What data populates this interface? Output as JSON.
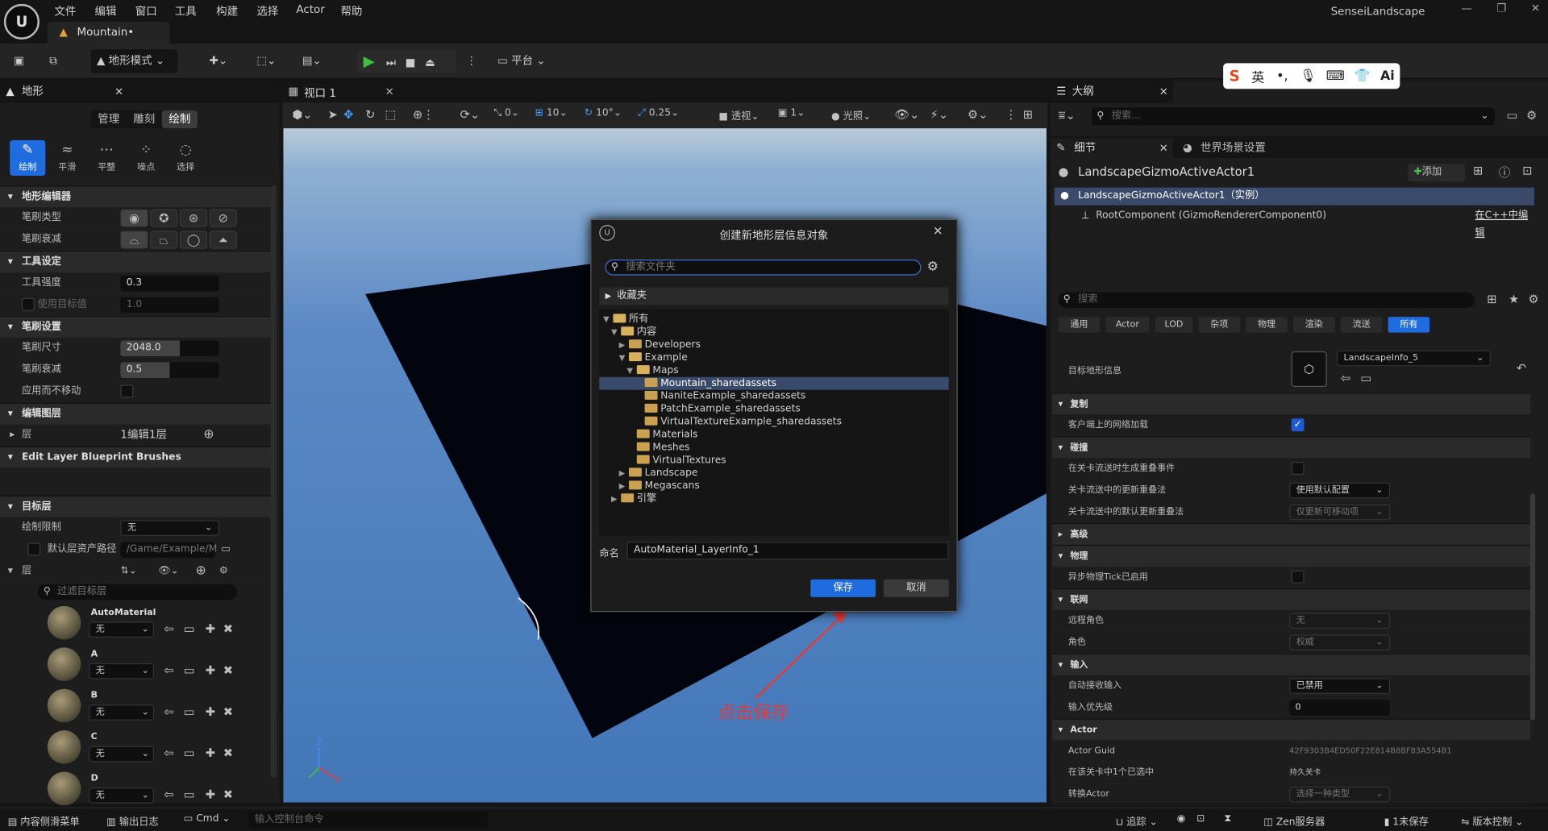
{
  "menu": [
    "文件",
    "编辑",
    "窗口",
    "工具",
    "构建",
    "选择",
    "Actor",
    "帮助"
  ],
  "window_title": "SenseiLandscape",
  "window_controls": [
    "—",
    "❐",
    "✕"
  ],
  "doc_tab": "Mountain•",
  "toolbar": {
    "mode": "地形模式",
    "platform": "平台"
  },
  "left_panel": {
    "title": "地形",
    "close": "×",
    "modes": [
      "管理",
      "雕刻",
      "绘制"
    ],
    "tools": [
      "绘制",
      "平滑",
      "平整",
      "噪点",
      "选择"
    ],
    "sections": {
      "editor": "地形编辑器",
      "tool_settings": "工具设定",
      "brush_settings": "笔刷设置",
      "edit_layers": "编辑图层",
      "blueprint": "Edit Layer Blueprint Brushes",
      "target_layers": "目标层"
    },
    "props": {
      "brush_type": "笔刷类型",
      "brush_falloff": "笔刷衰减",
      "tool_strength": "工具强度",
      "tool_strength_val": "0.3",
      "use_target": "使用目标值",
      "use_target_val": "1.0",
      "brush_size": "笔刷尺寸",
      "brush_size_val": "2048.0",
      "falloff": "笔刷衰减",
      "falloff_val": "0.5",
      "apply_no_move": "应用而不移动",
      "layer": "层",
      "layer_val": "1编辑1层",
      "paint_limit": "绘制限制",
      "paint_limit_val": "无",
      "default_path": "默认层资产路径",
      "default_path_val": "/Game/Example/M",
      "layers": "层"
    },
    "filter_placeholder": "过滤目标层",
    "layer_items": [
      {
        "name": "AutoMaterial",
        "val": "无"
      },
      {
        "name": "A",
        "val": "无"
      },
      {
        "name": "B",
        "val": "无"
      },
      {
        "name": "C",
        "val": "无"
      },
      {
        "name": "D",
        "val": "无"
      }
    ]
  },
  "viewport": {
    "tab": "视口 1",
    "perspective": "透视",
    "lit": "光照",
    "snap_move": "10",
    "snap_rot": "10°",
    "snap_scale": "0.25",
    "zero": "0",
    "one": "1",
    "axis_z": "Z",
    "axis_x": "X",
    "annotation": "点击保存"
  },
  "dialog": {
    "title": "创建新地形层信息对象",
    "close": "✕",
    "search_placeholder": "搜索文件夹",
    "favorites": "收藏夹",
    "tree": [
      {
        "label": "所有",
        "depth": 0,
        "arrow": "▼",
        "open": true
      },
      {
        "label": "内容",
        "depth": 1,
        "arrow": "▼",
        "open": true
      },
      {
        "label": "Developers",
        "depth": 2,
        "arrow": "▶",
        "open": false
      },
      {
        "label": "Example",
        "depth": 2,
        "arrow": "▼",
        "open": true
      },
      {
        "label": "Maps",
        "depth": 3,
        "arrow": "▼",
        "open": true
      },
      {
        "label": "Mountain_sharedassets",
        "depth": 4,
        "arrow": "",
        "open": false,
        "selected": true
      },
      {
        "label": "NaniteExample_sharedassets",
        "depth": 4,
        "arrow": "",
        "open": false
      },
      {
        "label": "PatchExample_sharedassets",
        "depth": 4,
        "arrow": "",
        "open": false
      },
      {
        "label": "VirtualTextureExample_sharedassets",
        "depth": 4,
        "arrow": "",
        "open": false
      },
      {
        "label": "Materials",
        "depth": 3,
        "arrow": "",
        "open": false
      },
      {
        "label": "Meshes",
        "depth": 3,
        "arrow": "",
        "open": false
      },
      {
        "label": "VirtualTextures",
        "depth": 3,
        "arrow": "",
        "open": false
      },
      {
        "label": "Landscape",
        "depth": 2,
        "arrow": "▶",
        "open": false
      },
      {
        "label": "Megascans",
        "depth": 2,
        "arrow": "▶",
        "open": false
      },
      {
        "label": "引擎",
        "depth": 1,
        "arrow": "▶",
        "open": false
      }
    ],
    "name_label": "命名",
    "name_value": "AutoMaterial_LayerInfo_1",
    "save": "保存",
    "cancel": "取消"
  },
  "outliner": {
    "title": "大纲",
    "close": "×",
    "search_placeholder": "搜索..."
  },
  "details": {
    "tab_details": "细节",
    "tab_world": "世界场景设置",
    "close": "×",
    "actor_name": "LandscapeGizmoActiveActor1",
    "add": "添加",
    "instance": "LandscapeGizmoActiveActor1（实例）",
    "root": "RootComponent (GizmoRendererComponent0)",
    "edit_cpp": "在C++中编辑",
    "search_placeholder": "搜索",
    "filters": [
      "通用",
      "Actor",
      "LOD",
      "杂项",
      "物理",
      "渲染",
      "流送",
      "所有"
    ],
    "target_info_label": "目标地形信息",
    "target_info_val": "LandscapeInfo_5",
    "rows": [
      {
        "type": "section",
        "label": "复制"
      },
      {
        "type": "check",
        "label": "客户端上的网络加载",
        "checked": true
      },
      {
        "type": "section",
        "label": "碰撞"
      },
      {
        "type": "check",
        "label": "在关卡流送时生成重叠事件",
        "checked": false
      },
      {
        "type": "dropdown",
        "label": "关卡流送中的更新重叠法",
        "val": "使用默认配置",
        "dim": false
      },
      {
        "type": "dropdown",
        "label": "关卡流送中的默认更新重叠法",
        "val": "仅更新可移动项",
        "dim": true
      },
      {
        "type": "section",
        "label": "高级",
        "collapsed": true
      },
      {
        "type": "section",
        "label": "物理"
      },
      {
        "type": "check",
        "label": "异步物理Tick已启用",
        "checked": false
      },
      {
        "type": "section",
        "label": "联网"
      },
      {
        "type": "dropdown",
        "label": "远程角色",
        "val": "无",
        "dim": true
      },
      {
        "type": "dropdown",
        "label": "角色",
        "val": "权威",
        "dim": true
      },
      {
        "type": "section",
        "label": "输入"
      },
      {
        "type": "dropdown",
        "label": "自动接收输入",
        "val": "已禁用",
        "dim": false
      },
      {
        "type": "text",
        "label": "输入优先级",
        "val": "0"
      },
      {
        "type": "section",
        "label": "Actor"
      },
      {
        "type": "static",
        "label": "Actor Guid",
        "val": "42F9303B4ED50F22E814B8BF83A554B1"
      },
      {
        "type": "static",
        "label": "在该关卡中1个已选中",
        "val": "持久关卡"
      },
      {
        "type": "dropdown",
        "label": "转换Actor",
        "val": "选择一种类型",
        "dim": true
      }
    ]
  },
  "ime": {
    "lang": "英"
  },
  "statusbar": {
    "drawer": "内容侧滑菜单",
    "log": "输出日志",
    "cmd": "Cmd",
    "console_placeholder": "输入控制台命令",
    "trace": "追踪",
    "zen": "Zen服务器",
    "unsaved": "1未保存",
    "vcs": "版本控制"
  }
}
